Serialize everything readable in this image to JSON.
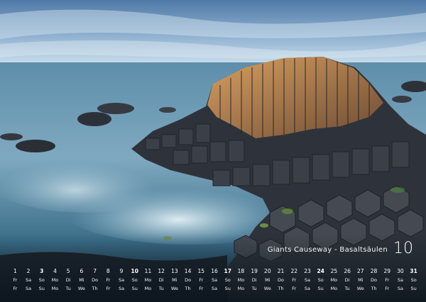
{
  "caption": "Giants Causeway - Basaltsäulen",
  "month_number": "10",
  "calendar": {
    "days": [
      "1",
      "2",
      "3",
      "4",
      "5",
      "6",
      "7",
      "8",
      "9",
      "10",
      "11",
      "12",
      "13",
      "14",
      "15",
      "16",
      "17",
      "18",
      "19",
      "20",
      "21",
      "22",
      "23",
      "24",
      "25",
      "26",
      "27",
      "28",
      "29",
      "30",
      "31"
    ],
    "weekday_row_1": [
      "Fr",
      "Sa",
      "So",
      "Mo",
      "Di",
      "Mi",
      "Do",
      "Fr",
      "Sa",
      "So",
      "Mo",
      "Di",
      "Mi",
      "Do",
      "Fr",
      "Sa",
      "So",
      "Mo",
      "Di",
      "Mi",
      "Do",
      "Fr",
      "Sa",
      "So",
      "Mo",
      "Di",
      "Mi",
      "Do",
      "Fr",
      "Sa",
      "So"
    ],
    "weekday_row_2": [
      "Fr",
      "Sa",
      "Su",
      "Mo",
      "Tu",
      "We",
      "Th",
      "Fr",
      "Sa",
      "Su",
      "Mo",
      "Tu",
      "We",
      "Th",
      "Fr",
      "Sa",
      "Su",
      "Mo",
      "Tu",
      "We",
      "Th",
      "Fr",
      "Sa",
      "Su",
      "Mo",
      "Tu",
      "We",
      "Th",
      "Fr",
      "Sa",
      "Su"
    ],
    "highlighted_days": [
      3,
      10,
      17,
      24,
      31
    ]
  },
  "colors": {
    "sky": "#5f86b0",
    "sea": "#3e6f8c",
    "mist": "#cfe3ee",
    "basalt_dark": "#2b2f36",
    "basalt_lit": "#b07a45",
    "text": "#ffffff"
  }
}
